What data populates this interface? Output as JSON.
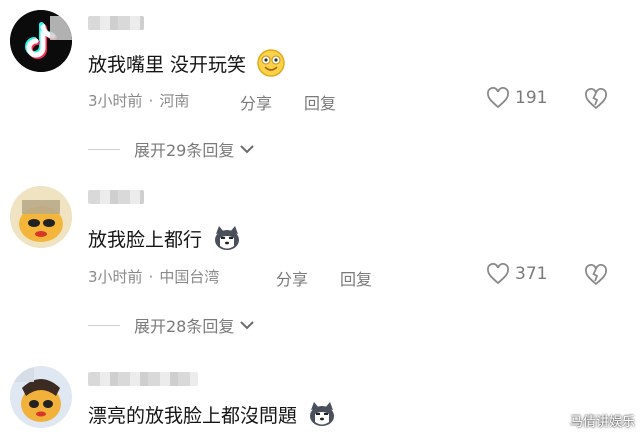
{
  "comments": [
    {
      "text": "放我嘴里 没开玩笑",
      "emoji": "smile-emoji",
      "time": "3小时前",
      "location": "河南",
      "share_label": "分享",
      "reply_label": "回复",
      "likes": "191",
      "expand_label": "展开29条回复"
    },
    {
      "text": "放我脸上都行",
      "emoji": "husky-emoji",
      "time": "3小时前",
      "location": "中国台湾",
      "share_label": "分享",
      "reply_label": "回复",
      "likes": "371",
      "expand_label": "展开28条回复"
    },
    {
      "text": "漂亮的放我脸上都沒問題",
      "emoji": "husky-emoji"
    }
  ],
  "watermark": "马倩讲娱乐",
  "colors": {
    "tiktok_cyan": "#25F4EE",
    "tiktok_red": "#FE2C55",
    "meta_gray": "#8a8a8a"
  }
}
